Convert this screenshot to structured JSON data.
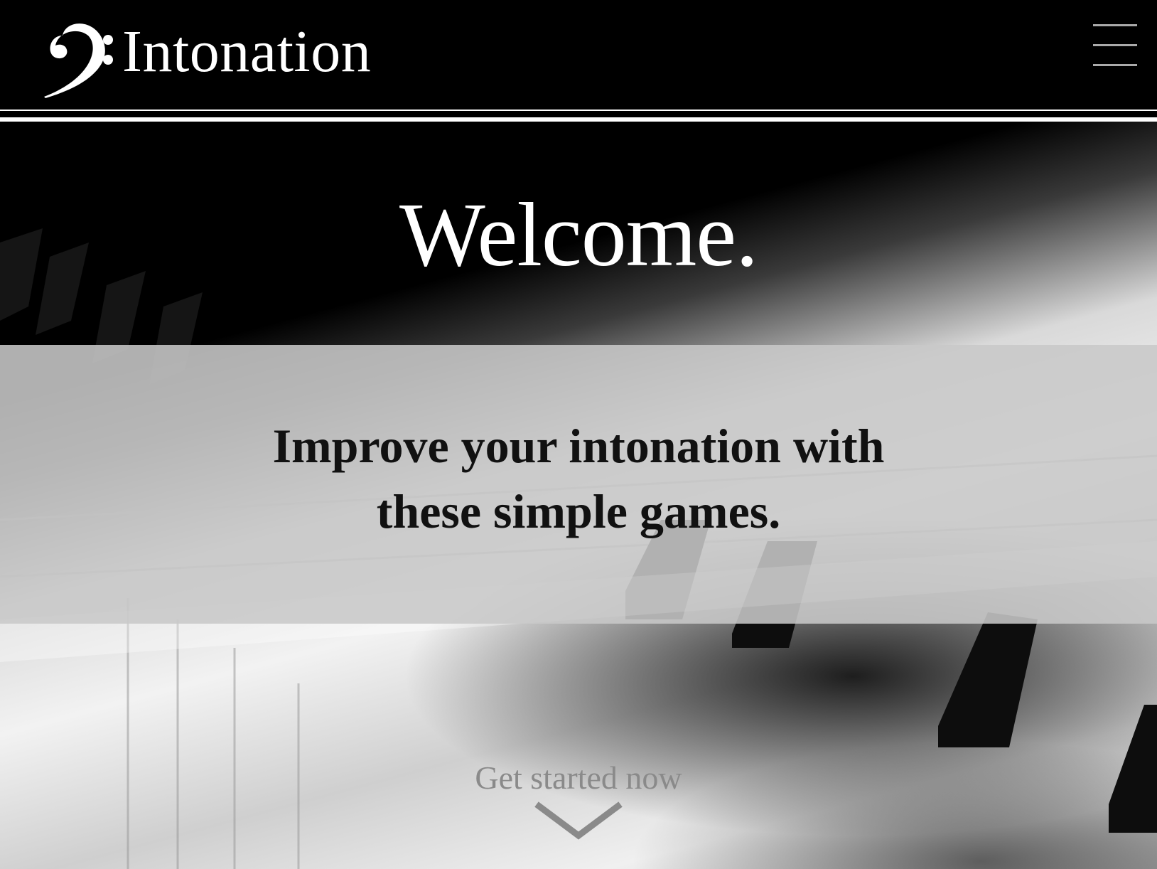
{
  "header": {
    "brand": "Intonation",
    "logo_icon": "bass-clef-icon",
    "menu_icon": "hamburger-menu-icon"
  },
  "hero": {
    "heading": "Welcome.",
    "tagline": "Improve your intonation with these simple games.",
    "cta_label": "Get started now",
    "cta_icon": "chevron-down-icon",
    "background": "piano-keys-photo"
  },
  "colors": {
    "header_bg": "#000000",
    "divider": "#ffffff",
    "band_bg": "#c8c8c8",
    "tagline_text": "#111111",
    "cta_text": "#8a8a8a"
  }
}
